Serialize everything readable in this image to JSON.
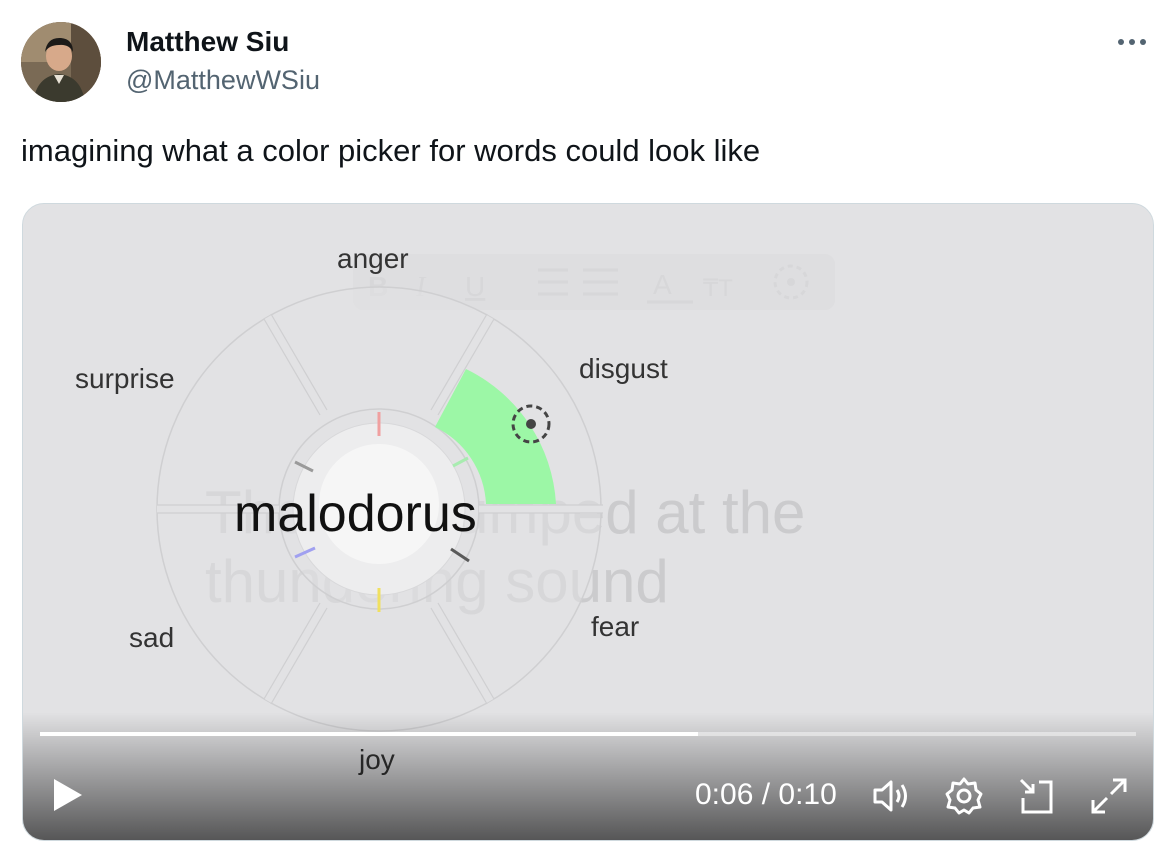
{
  "tweet": {
    "author_name": "Matthew Siu",
    "author_handle": "@MatthewWSiu",
    "text": "imagining what a color picker for words could look like",
    "more_icon": "more-options-icon"
  },
  "video": {
    "emotion_labels": {
      "anger": "anger",
      "disgust": "disgust",
      "fear": "fear",
      "joy": "joy",
      "sad": "sad",
      "surprise": "surprise"
    },
    "center_word": "malodorus",
    "background_text_line1": "The dog jumped at the",
    "background_text_line2": "thundering sound",
    "selected_emotion_color": "#9cf7a6",
    "progress": 0.6,
    "time_display": "0:06 / 0:10",
    "controls": [
      "play-icon",
      "volume-icon",
      "settings-icon",
      "picture-in-picture-icon",
      "fullscreen-icon"
    ]
  }
}
